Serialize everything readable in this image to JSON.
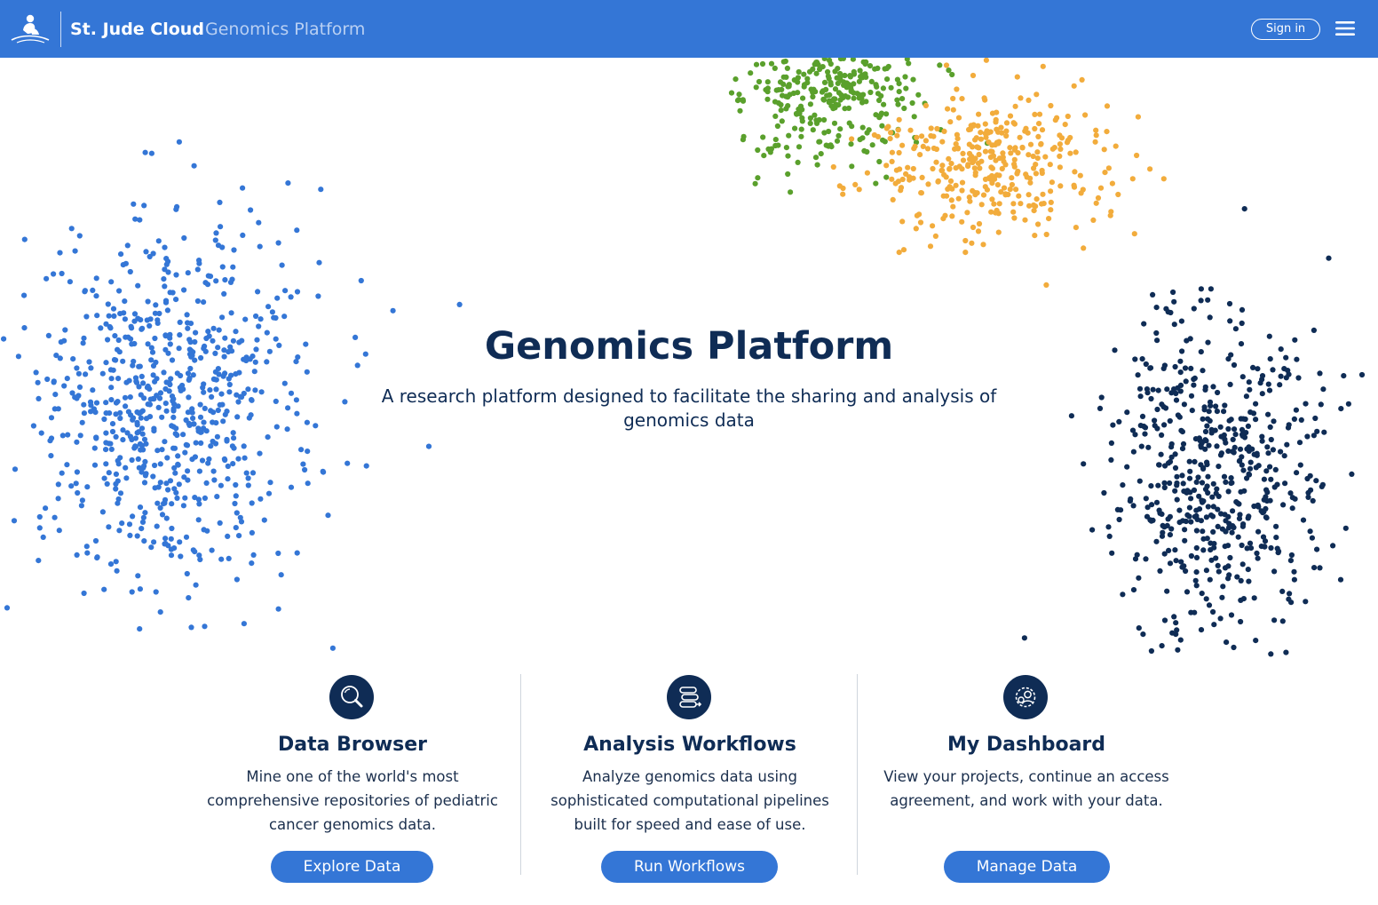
{
  "header": {
    "brand_name": "St. Jude Cloud",
    "brand_subtitle": "Genomics Platform",
    "signin_label": "Sign in",
    "logo_icon": "st-jude-logo-icon",
    "menu_icon": "hamburger-menu-icon",
    "background_color": "#3476d6"
  },
  "hero": {
    "title": "Genomics Platform",
    "subtitle": "A research platform designed to facilitate the sharing and analysis of genomics data"
  },
  "decorations": {
    "cluster_colors": {
      "blue": "#3476d6",
      "green": "#5aa02c",
      "orange": "#f2ac3c",
      "navy": "#0f2c55"
    }
  },
  "features": [
    {
      "title": "Data Browser",
      "description": "Mine one of the world's most comprehensive repositories of pediatric cancer genomics data.",
      "button_label": "Explore Data",
      "icon": "magnifier-icon"
    },
    {
      "title": "Analysis Workflows",
      "description": "Analyze genomics data using sophisticated computational pipelines built for speed and ease of use.",
      "button_label": "Run Workflows",
      "icon": "workflow-icon"
    },
    {
      "title": "My Dashboard",
      "description": "View your projects, continue an access agreement, and work with your data.",
      "button_label": "Manage Data",
      "icon": "user-gear-icon"
    }
  ]
}
